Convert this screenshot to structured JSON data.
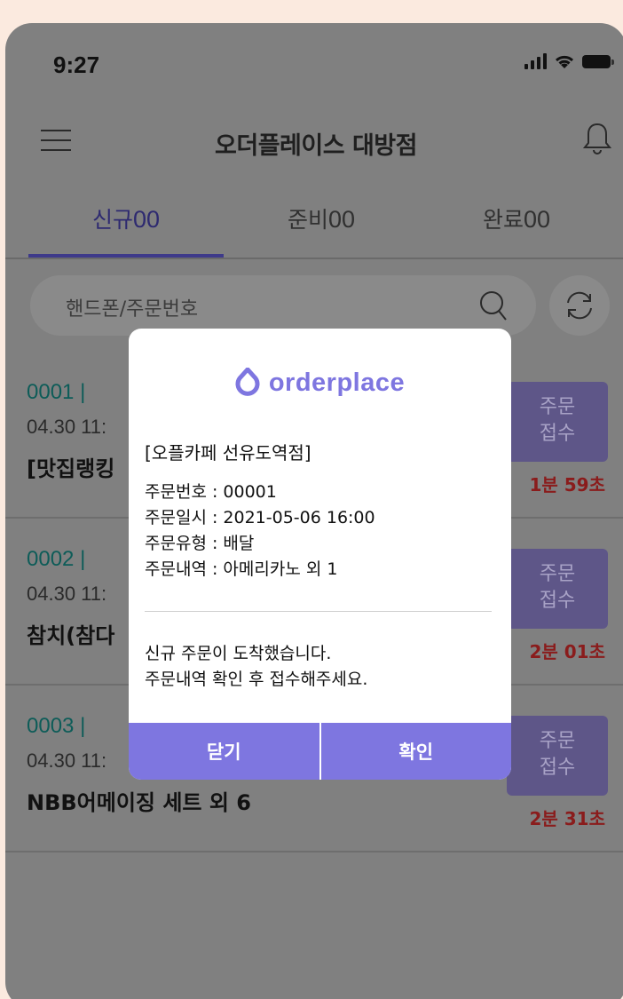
{
  "status_bar": {
    "time": "9:27"
  },
  "header": {
    "title": "오더플레이스 대방점"
  },
  "tabs": [
    {
      "label": "신규",
      "count": "00",
      "active": true
    },
    {
      "label": "준비",
      "count": "00",
      "active": false
    },
    {
      "label": "완료",
      "count": "00",
      "active": false
    }
  ],
  "search": {
    "placeholder": "핸드폰/주문번호"
  },
  "orders": [
    {
      "id": "0001",
      "sep": "|",
      "time": "04.30 11:",
      "menu": "[맛집랭킹",
      "accept_line1": "주문",
      "accept_line2": "접수",
      "elapsed": "1분 59초"
    },
    {
      "id": "0002",
      "sep": "|",
      "time": "04.30 11:",
      "menu": "참치(참다",
      "accept_line1": "주문",
      "accept_line2": "접수",
      "elapsed": "2분 01초"
    },
    {
      "id": "0003",
      "sep": "|",
      "time": "04.30 11:",
      "menu": "NBB어메이징 세트 외 6",
      "accept_line1": "주문",
      "accept_line2": "접수",
      "elapsed": "2분 31초"
    }
  ],
  "modal": {
    "logo_text": "orderplace",
    "store_name": "[오플카페 선유도역점]",
    "order_number": "주문번호 : 00001",
    "order_datetime": "주문일시 : 2021-05-06 16:00",
    "order_type": "주문유형 : 배달",
    "order_items": "주문내역 : 아메리카노 외 1",
    "message_line1": "신규 주문이 도착했습니다.",
    "message_line2": "주문내역 확인 후 접수해주세요.",
    "close_label": "닫기",
    "confirm_label": "확인"
  },
  "colors": {
    "accent": "#7e76e0",
    "page_background": "#fbeadf",
    "overlay": "#808080",
    "elapsed_red": "#8a1c1c"
  }
}
